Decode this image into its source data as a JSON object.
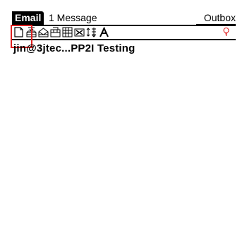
{
  "titlebar": {
    "app_name": "Email",
    "message_count": "1 Message",
    "folder": "Outbox"
  },
  "toolbar": {
    "icons": [
      "new-message-icon",
      "inbox-icon",
      "read-icon",
      "unread-icon",
      "calendar-icon",
      "delete-icon",
      "sort-icon",
      "font-icon",
      "attention-icon"
    ],
    "highlight_color": "#e02020"
  },
  "messages": [
    {
      "summary": "jin@3jtec...PP2I Testing"
    }
  ]
}
